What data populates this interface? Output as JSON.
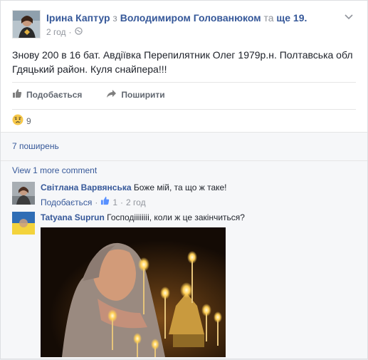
{
  "post": {
    "author": "Ірина Каптур",
    "with_word": "з",
    "tagged": "Володимиром Голованюком",
    "and_word": "та",
    "others": "ще 19.",
    "time": "2 год",
    "separator": "·",
    "text": "Знову 200 в 16 бат. Авдіївка Перепилятник Олег 1979р.н. Полтавська обл Гдяцький район. Куля снайпера!!!"
  },
  "actions": {
    "like_label": "Подобається",
    "share_label": "Поширити"
  },
  "reactions": {
    "count": "9"
  },
  "shares": {
    "label": "7 поширень"
  },
  "comments": {
    "view_more": "View 1 more comment",
    "items": [
      {
        "author": "Світлана Варвянська",
        "text": "Боже мій, та що ж таке!",
        "like_label": "Подобається",
        "like_count": "1",
        "separator": "·",
        "time": "2 год"
      },
      {
        "author": "Tatyana Suprun",
        "text": "Господіііііііі, коли ж це закінчиться?"
      }
    ]
  },
  "colors": {
    "link": "#365899",
    "muted": "#90949c",
    "action": "#616770",
    "background": "#f6f7f9"
  }
}
